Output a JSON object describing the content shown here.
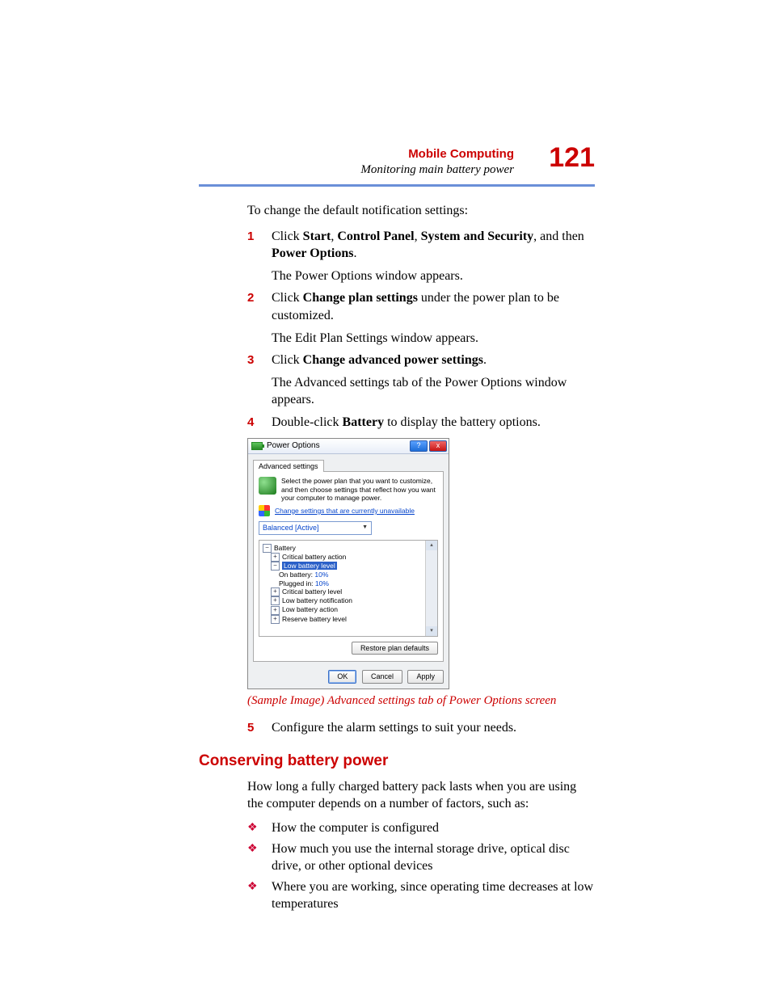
{
  "header": {
    "section": "Mobile Computing",
    "subsection": "Monitoring main battery power",
    "page_number": "121"
  },
  "intro": "To change the default notification settings:",
  "steps": {
    "s1": {
      "num": "1",
      "pre": "Click ",
      "b1": "Start",
      "sep1": ", ",
      "b2": "Control Panel",
      "sep2": ", ",
      "b3": "System and Security",
      "sep3": ", and then ",
      "b4": "Power Options",
      "post": ".",
      "result": "The Power Options window appears."
    },
    "s2": {
      "num": "2",
      "pre": "Click ",
      "b1": "Change plan settings",
      "post": " under the power plan to be customized.",
      "result": "The Edit Plan Settings window appears."
    },
    "s3": {
      "num": "3",
      "pre": "Click ",
      "b1": "Change advanced power settings",
      "post": ".",
      "result": "The Advanced settings tab of the Power Options window appears."
    },
    "s4": {
      "num": "4",
      "pre": "Double-click ",
      "b1": "Battery",
      "post": " to display the battery options."
    },
    "s5": {
      "num": "5",
      "text": "Configure the alarm settings to suit your needs."
    }
  },
  "screenshot": {
    "title": "Power Options",
    "help": "?",
    "close": "x",
    "tab": "Advanced settings",
    "description": "Select the power plan that you want to customize, and then choose settings that reflect how you want your computer to manage power.",
    "link": "Change settings that are currently unavailable",
    "plan": "Balanced [Active]",
    "tree": {
      "root": "Battery",
      "n1": "Critical battery action",
      "n2": "Low battery level",
      "n2a_label": "On battery:",
      "n2a_val": " 10%",
      "n2b_label": "Plugged in:",
      "n2b_val": " 10%",
      "n3": "Critical battery level",
      "n4": "Low battery notification",
      "n5": "Low battery action",
      "n6": "Reserve battery level"
    },
    "restore": "Restore plan defaults",
    "ok": "OK",
    "cancel": "Cancel",
    "apply": "Apply"
  },
  "caption": "(Sample Image) Advanced settings tab of Power Options screen",
  "h2": "Conserving battery power",
  "p_after_h2": "How long a fully charged battery pack lasts when you are using the computer depends on a number of factors, such as:",
  "bullets": {
    "b1": "How the computer is configured",
    "b2": "How much you use the internal storage drive, optical disc drive, or other optional devices",
    "b3": "Where you are working, since operating time decreases at low temperatures"
  }
}
